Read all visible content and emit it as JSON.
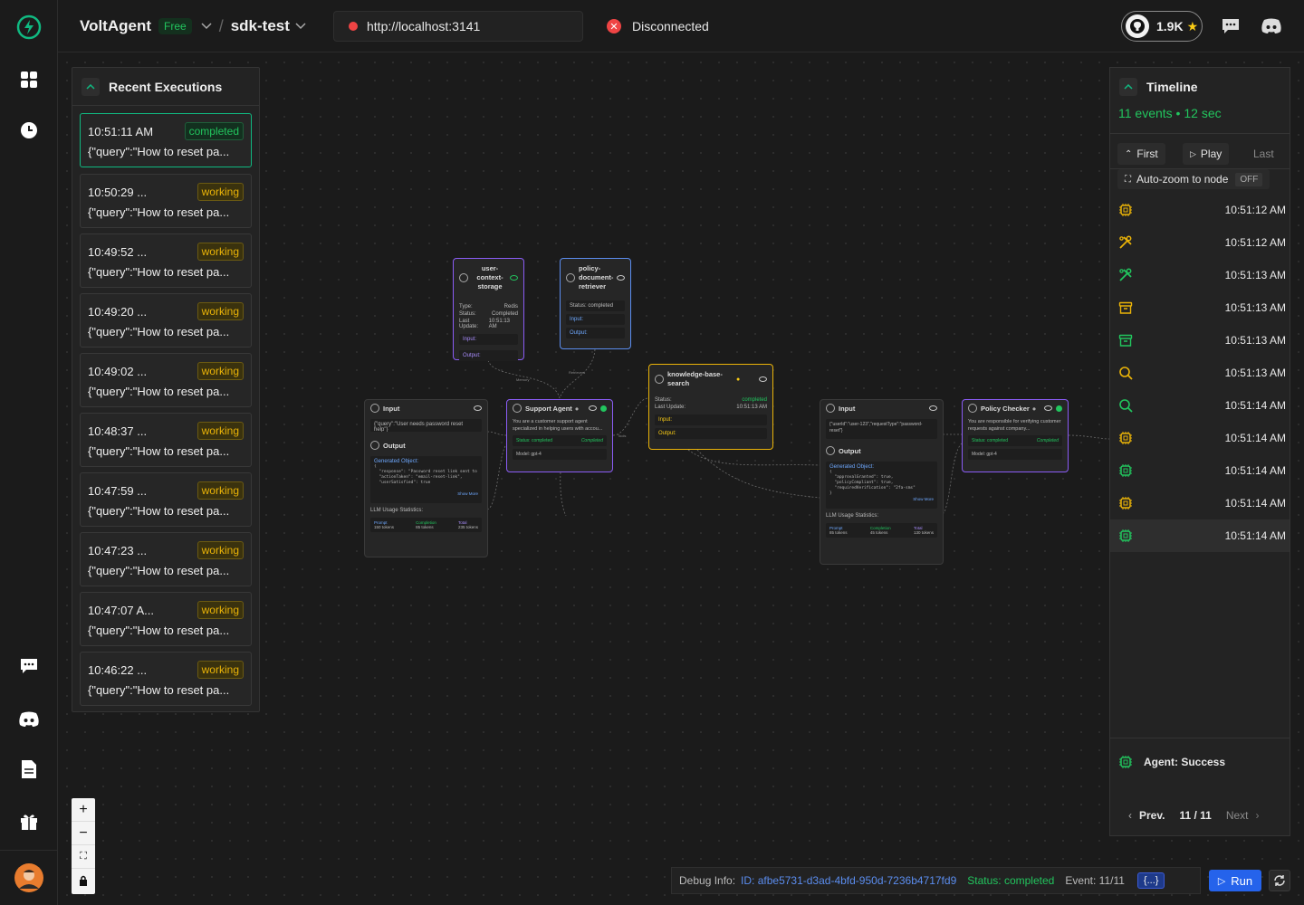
{
  "header": {
    "brand": "VoltAgent",
    "plan_badge": "Free",
    "separator": "/",
    "project": "sdk-test",
    "url": "http://localhost:3141",
    "connection_status": "Disconnected",
    "github_stars": "1.9K"
  },
  "recent": {
    "title": "Recent Executions",
    "items": [
      {
        "time": "10:51:11 AM",
        "status": "completed",
        "query": "{\"query\":\"How to reset pa..."
      },
      {
        "time": "10:50:29 ...",
        "status": "working",
        "query": "{\"query\":\"How to reset pa..."
      },
      {
        "time": "10:49:52 ...",
        "status": "working",
        "query": "{\"query\":\"How to reset pa..."
      },
      {
        "time": "10:49:20 ...",
        "status": "working",
        "query": "{\"query\":\"How to reset pa..."
      },
      {
        "time": "10:49:02 ...",
        "status": "working",
        "query": "{\"query\":\"How to reset pa..."
      },
      {
        "time": "10:48:37 ...",
        "status": "working",
        "query": "{\"query\":\"How to reset pa..."
      },
      {
        "time": "10:47:59 ...",
        "status": "working",
        "query": "{\"query\":\"How to reset pa..."
      },
      {
        "time": "10:47:23 ...",
        "status": "working",
        "query": "{\"query\":\"How to reset pa..."
      },
      {
        "time": "10:47:07 A...",
        "status": "working",
        "query": "{\"query\":\"How to reset pa..."
      },
      {
        "time": "10:46:22 ...",
        "status": "working",
        "query": "{\"query\":\"How to reset pa..."
      }
    ]
  },
  "nodes": {
    "user_context": {
      "title": "user-context-storage",
      "type_label": "Type:",
      "type_value": "Redis",
      "status_label": "Status:",
      "status_value": "Completed",
      "update_label": "Last Update:",
      "update_value": "10:51:13 AM",
      "input": "Input:",
      "output": "Output:"
    },
    "policy_retriever": {
      "title": "policy-document-retriever",
      "status": "Status: completed",
      "input": "Input:",
      "output": "Output:"
    },
    "kb_search": {
      "title": "knowledge-base-search",
      "status_label": "Status:",
      "status_value": "completed",
      "update_label": "Last Update:",
      "update_value": "10:51:13 AM",
      "input": "Input:",
      "output": "Output:"
    },
    "input1": {
      "title": "Input",
      "value": "{\"query\":\"User needs password reset help\"}",
      "output_title": "Output",
      "gen_label": "Generated Object:",
      "gen_value": "{\n  \"response\": \"Password reset link sent to user's email\",\n  \"actionTaken\": \"email-reset-link\",\n  \"userSatisfied\": true",
      "show_more": "Show More",
      "usage_label": "LLM Usage Statistics:",
      "prompt_label": "Prompt",
      "prompt_value": "150 tokens",
      "completion_label": "Completion",
      "completion_value": "85 tokens",
      "total_label": "Total",
      "total_value": "235 tokens"
    },
    "support_agent": {
      "title": "Support Agent",
      "desc": "You are a customer support agent specialized in helping users with accou...",
      "status": "Status: completed",
      "status_right": "Completed",
      "model": "Model: gpt-4"
    },
    "input2": {
      "title": "Input",
      "value": "{\"userId\":\"user-123\",\"requestType\":\"password-reset\"}",
      "output_title": "Output",
      "gen_label": "Generated Object:",
      "gen_value": "{\n  \"approvalGranted\": true,\n  \"policyCompliant\": true,\n  \"requiredVerification\": \"2fa-sms\"\n}",
      "show_more": "Show More",
      "usage_label": "LLM Usage Statistics:",
      "prompt_label": "Prompt",
      "prompt_value": "85 tokens",
      "completion_label": "Completion",
      "completion_value": "45 tokens",
      "total_label": "Total",
      "total_value": "130 tokens"
    },
    "policy_checker": {
      "title": "Policy Checker",
      "desc": "You are responsible for verifying customer requests against company...",
      "status": "Status: completed",
      "status_right": "Completed",
      "model": "Model: gpt-4"
    },
    "edge_labels": {
      "memory": "Memory",
      "retrievers": "Retrievers",
      "tools": "Tools"
    }
  },
  "timeline": {
    "title": "Timeline",
    "summary": "11 events • 12 sec",
    "first": "First",
    "play": "Play",
    "last": "Last",
    "autozoom": "Auto-zoom to node",
    "autozoom_state": "OFF",
    "events": [
      {
        "icon": "cpu-icon",
        "color": "#eab308",
        "time": "10:51:12 AM"
      },
      {
        "icon": "tools-icon",
        "color": "#eab308",
        "time": "10:51:12 AM"
      },
      {
        "icon": "tools-icon",
        "color": "#22c55e",
        "time": "10:51:13 AM"
      },
      {
        "icon": "archive-icon",
        "color": "#eab308",
        "time": "10:51:13 AM"
      },
      {
        "icon": "archive-icon",
        "color": "#22c55e",
        "time": "10:51:13 AM"
      },
      {
        "icon": "search-icon",
        "color": "#eab308",
        "time": "10:51:13 AM"
      },
      {
        "icon": "search-icon",
        "color": "#22c55e",
        "time": "10:51:14 AM"
      },
      {
        "icon": "cpu-icon",
        "color": "#eab308",
        "time": "10:51:14 AM"
      },
      {
        "icon": "cpu-icon",
        "color": "#22c55e",
        "time": "10:51:14 AM"
      },
      {
        "icon": "cpu-icon",
        "color": "#eab308",
        "time": "10:51:14 AM"
      },
      {
        "icon": "cpu-icon",
        "color": "#22c55e",
        "time": "10:51:14 AM"
      }
    ],
    "agent_status": "Agent: Success",
    "prev": "Prev.",
    "page": "11 / 11",
    "next": "Next"
  },
  "debug": {
    "label": "Debug Info:",
    "id": "ID: afbe5731-d3ad-4bfd-950d-7236b4717fd9",
    "status": "Status: completed",
    "event": "Event: 11/11",
    "json_button": "{...}",
    "run": "Run"
  },
  "colors": {
    "accent_green": "#22c55e",
    "working_yellow": "#eab308",
    "run_blue": "#2563eb",
    "error_red": "#ef4444"
  }
}
